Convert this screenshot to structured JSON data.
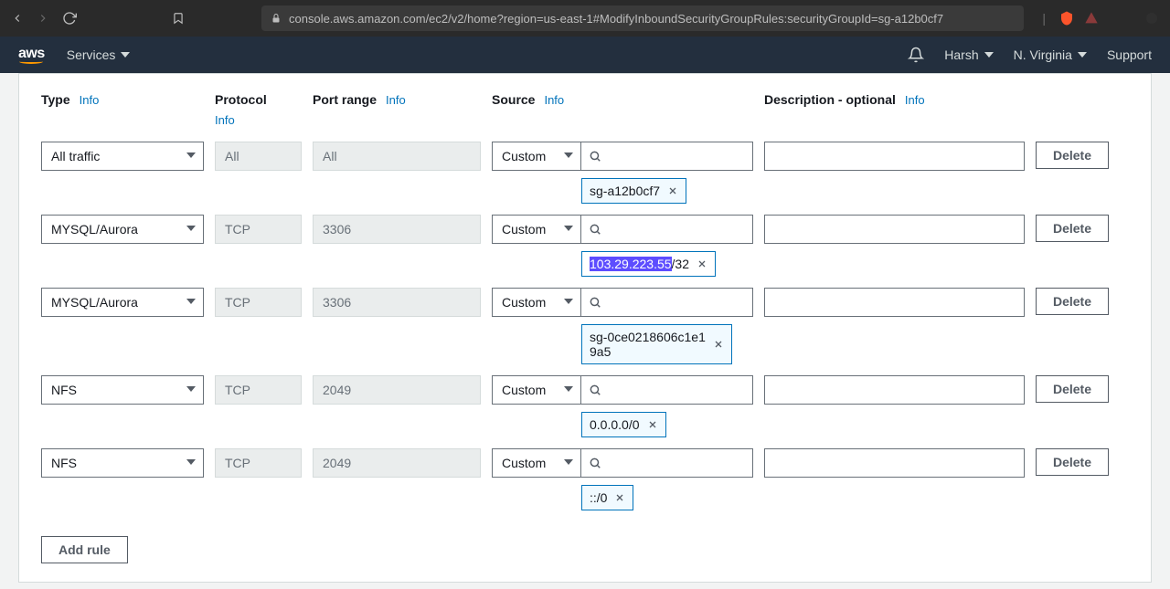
{
  "browser": {
    "url": "console.aws.amazon.com/ec2/v2/home?region=us-east-1#ModifyInboundSecurityGroupRules:securityGroupId=sg-a12b0cf7"
  },
  "nav": {
    "services": "Services",
    "user": "Harsh",
    "region": "N. Virginia",
    "support": "Support"
  },
  "headers": {
    "type": "Type",
    "protocol": "Protocol",
    "port": "Port range",
    "source": "Source",
    "desc": "Description - optional",
    "info": "Info"
  },
  "labels": {
    "delete": "Delete",
    "addRule": "Add rule",
    "custom": "Custom"
  },
  "rules": [
    {
      "type": "All traffic",
      "protocol": "All",
      "port": "All",
      "source": "Custom",
      "tag": "sg-a12b0cf7",
      "tagHighlight": "",
      "tagSuffix": ""
    },
    {
      "type": "MYSQL/Aurora",
      "protocol": "TCP",
      "port": "3306",
      "source": "Custom",
      "tag": "",
      "tagHighlight": "103.29.223.55",
      "tagSuffix": "/32"
    },
    {
      "type": "MYSQL/Aurora",
      "protocol": "TCP",
      "port": "3306",
      "source": "Custom",
      "tag": "sg-0ce0218606c1e19a5",
      "tagHighlight": "",
      "tagSuffix": ""
    },
    {
      "type": "NFS",
      "protocol": "TCP",
      "port": "2049",
      "source": "Custom",
      "tag": "0.0.0.0/0",
      "tagHighlight": "",
      "tagSuffix": ""
    },
    {
      "type": "NFS",
      "protocol": "TCP",
      "port": "2049",
      "source": "Custom",
      "tag": "::/0",
      "tagHighlight": "",
      "tagSuffix": ""
    }
  ]
}
